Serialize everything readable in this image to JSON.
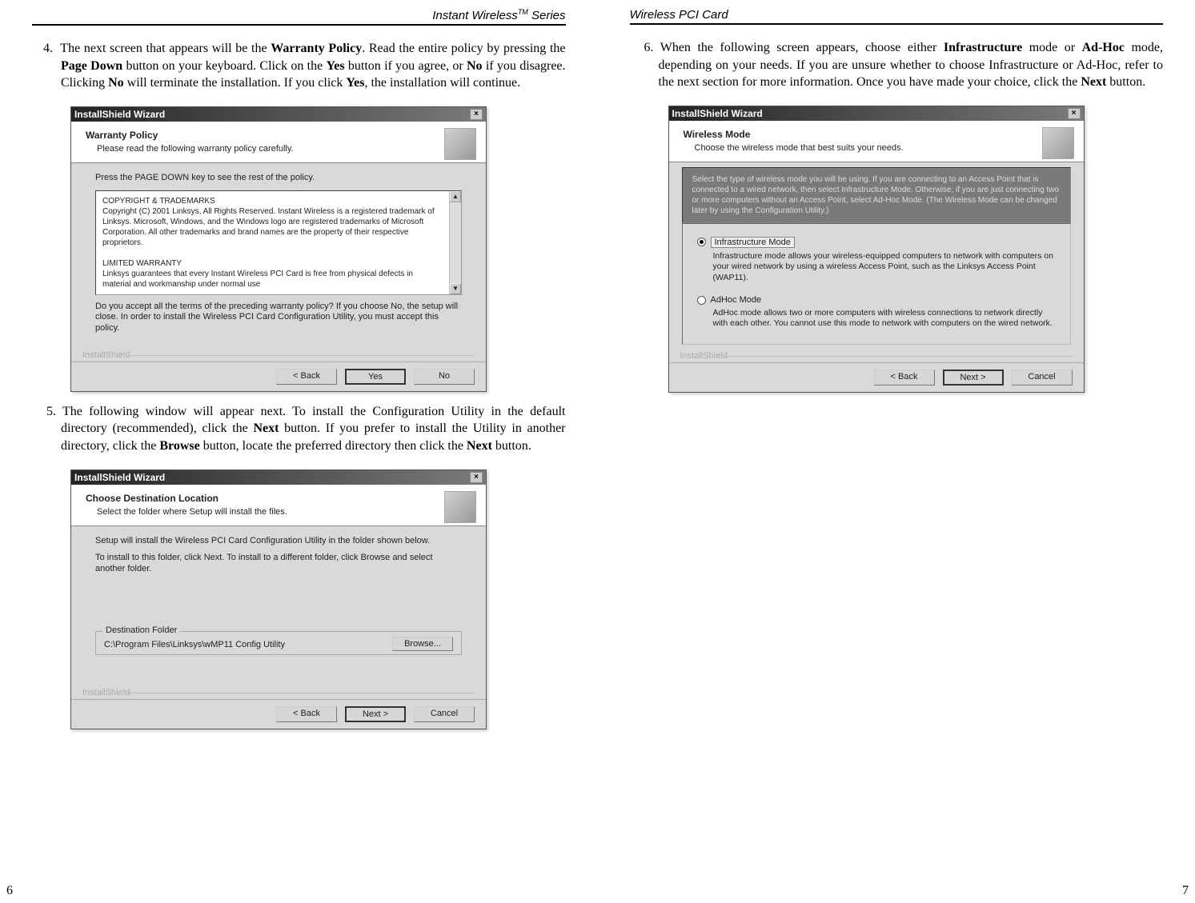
{
  "leftPage": {
    "header": "Instant Wireless",
    "headerTM": "TM",
    "headerSuffix": " Series",
    "pageNum": "6",
    "step4_num": "4.",
    "step4": "The next screen that appears will be the Warranty Policy.  Read the entire policy by pressing the Page Down button on your keyboard.  Click on the Yes button if you agree, or No if you disagree.  Clicking No will terminate the installation.  If you click Yes, the installation will continue.",
    "step5_num": "5.",
    "step5": "The following window will appear next.  To install the Configuration Utility in the default directory (recommended), click the Next button.    If you prefer to install the Utility in another directory, click the Browse button, locate the preferred directory then click the Next button."
  },
  "rightPage": {
    "header": "Wireless PCI Card",
    "pageNum": "7",
    "step6_num": "6.",
    "step6": "When the following screen appears, choose either Infrastructure mode or Ad-Hoc mode, depending on your needs.  If you are unsure whether to choose Infrastructure or Ad-Hoc, refer to the next section for more information.  Once you have made your choice, click the Next button."
  },
  "win1": {
    "title": "InstallShield Wizard",
    "close": "×",
    "topTitle": "Warranty Policy",
    "topSub": "Please read the following warranty policy carefully.",
    "p1": "Press the PAGE DOWN key to see the rest of the policy.",
    "copyHead": "COPYRIGHT & TRADEMARKS",
    "copyBody": "Copyright (C) 2001 Linksys, All Rights Reserved. Instant Wireless is a registered trademark of Linksys. Microsoft, Windows, and the Windows logo are registered trademarks of Microsoft Corporation. All other trademarks and brand names are the property of their respective proprietors.",
    "limHead": "LIMITED WARRANTY",
    "limBody": "Linksys guarantees that every Instant Wireless PCI Card is free from physical defects in material and workmanship under normal use",
    "p2": "Do you accept all the terms of the preceding warranty policy? If you choose No, the setup will close. In order to install the Wireless PCI Card Configuration Utility, you must accept this policy.",
    "brand": "InstallShield",
    "back": "< Back",
    "yes": "Yes",
    "no": "No"
  },
  "win2": {
    "title": "InstallShield Wizard",
    "close": "×",
    "topTitle": "Choose Destination Location",
    "topSub": "Select the folder where Setup will install the files.",
    "p1": "Setup will install the Wireless PCI Card Configuration Utility in the folder shown below.",
    "p2": "To install to this folder, click Next. To install to a different folder, click Browse and select another folder.",
    "groupLabel": "Destination Folder",
    "path": "C:\\Program Files\\Linksys\\wMP11 Config Utility",
    "browse": "Browse...",
    "brand": "InstallShield",
    "back": "< Back",
    "next": "Next >",
    "cancel": "Cancel"
  },
  "win3": {
    "title": "InstallShield Wizard",
    "close": "×",
    "topTitle": "Wireless Mode",
    "topSub": "Choose the wireless mode that best suits your needs.",
    "intro": "Select the type of wireless mode you will be using. If you are connecting to an Access Point that is connected to a wired network, then select Infrastructure Mode. Otherwise, if you are just connecting two or more computers without an Access Point, select Ad-Hoc Mode. (The Wireless Mode can be changed later by using the Configuration Utility.)",
    "mode1": "Infrastructure Mode",
    "mode1desc": "Infrastructure mode allows your wireless-equipped computers to network with computers on your wired network by using a wireless Access Point, such as the Linksys Access Point (WAP11).",
    "mode2": "AdHoc Mode",
    "mode2desc": "AdHoc mode allows two or more computers with wireless connections to network directly with each other. You cannot use this mode to network with computers on the wired network.",
    "brand": "InstallShield",
    "back": "< Back",
    "next": "Next >",
    "cancel": "Cancel"
  }
}
